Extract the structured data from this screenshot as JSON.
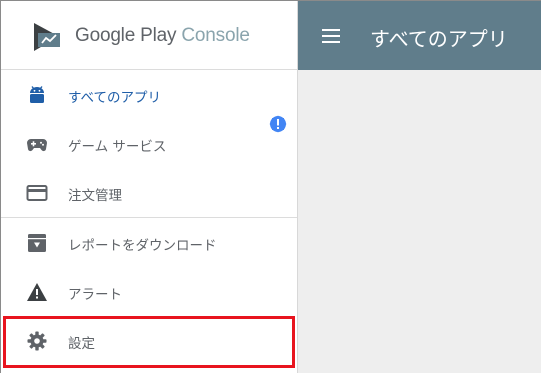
{
  "brand": {
    "name_part1": "Google Play",
    "name_part2": "Console"
  },
  "header": {
    "title": "すべてのアプリ"
  },
  "sidebar": {
    "items": [
      {
        "label": "すべてのアプリ",
        "icon": "android-icon",
        "active": true
      },
      {
        "label": "ゲーム サービス",
        "icon": "gamepad-icon"
      },
      {
        "label": "注文管理",
        "icon": "credit-card-icon"
      },
      {
        "label": "レポートをダウンロード",
        "icon": "download-box-icon"
      },
      {
        "label": "アラート",
        "icon": "warning-icon"
      },
      {
        "label": "設定",
        "icon": "gear-icon"
      }
    ]
  },
  "colors": {
    "header_bg": "#607d8b",
    "active_blue": "#1f5ea8",
    "badge_blue": "#4285f4",
    "highlight_red": "#e8141e"
  }
}
